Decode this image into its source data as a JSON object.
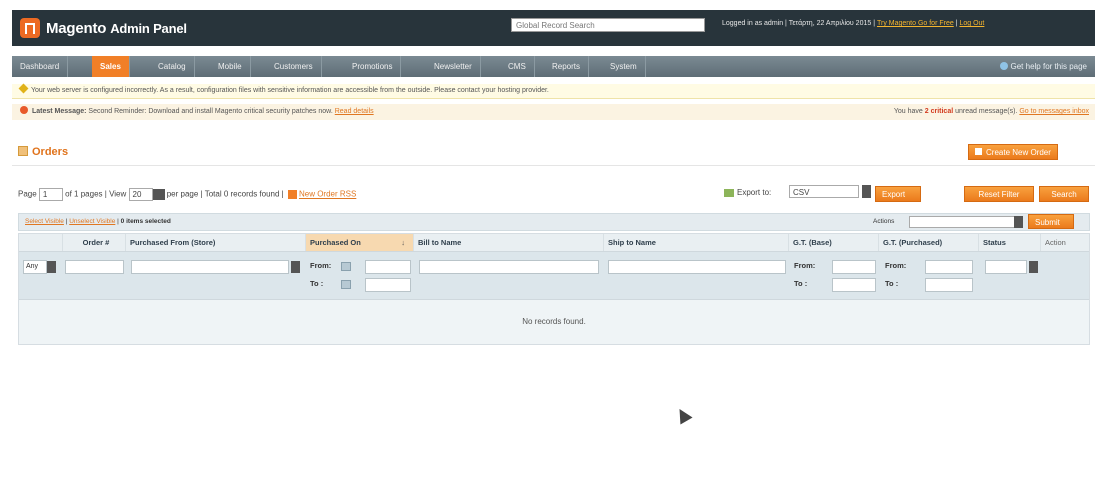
{
  "header": {
    "logo_main": "Magento",
    "logo_sub": "Admin Panel",
    "search_placeholder": "Global Record Search",
    "user_text": "Logged in as admin | Τετάρτη, 22 Απριλίου 2015 |",
    "try_link": "Try Magento Go for Free",
    "logout_link": "Log Out"
  },
  "nav": {
    "items": [
      "Dashboard",
      "Sales",
      "Catalog",
      "Mobile",
      "Customers",
      "Promotions",
      "Newsletter",
      "CMS",
      "Reports",
      "System"
    ],
    "active": "Sales",
    "help": "Get help for this page"
  },
  "notices": {
    "config_warning": "Your web server is configured incorrectly. As a result, configuration files with sensitive information are accessible from the outside. Please contact your hosting provider.",
    "latest_label": "Latest Message:",
    "latest_text": "Second Reminder: Download and install Magento critical security patches now.",
    "read_details": "Read details",
    "critical_prefix": "You have",
    "critical_count": "2 critical",
    "critical_suffix": "unread message(s).",
    "go_messages": "Go to messages inbox"
  },
  "page": {
    "title": "Orders",
    "create_button": "Create New Order"
  },
  "pager": {
    "page_label": "Page",
    "page_value": "1",
    "of_pages": "of 1 pages",
    "view_label": "View",
    "view_value": "20",
    "per_page": "per page",
    "total": "Total 0 records found",
    "rss_link": "New Order RSS",
    "export_label": "Export to:",
    "export_value": "CSV",
    "export_button": "Export",
    "reset_button": "Reset Filter",
    "search_button": "Search"
  },
  "massaction": {
    "select_visible": "Select Visible",
    "unselect_visible": "Unselect Visible",
    "selected": "0 items selected",
    "actions_label": "Actions",
    "submit": "Submit"
  },
  "grid": {
    "columns": [
      "",
      "Order #",
      "Purchased From (Store)",
      "Purchased On",
      "Bill to Name",
      "Ship to Name",
      "G.T. (Base)",
      "G.T. (Purchased)",
      "Status",
      "Action"
    ],
    "any_value": "Any",
    "from_label": "From:",
    "to_label": "To :",
    "empty_message": "No records found."
  }
}
